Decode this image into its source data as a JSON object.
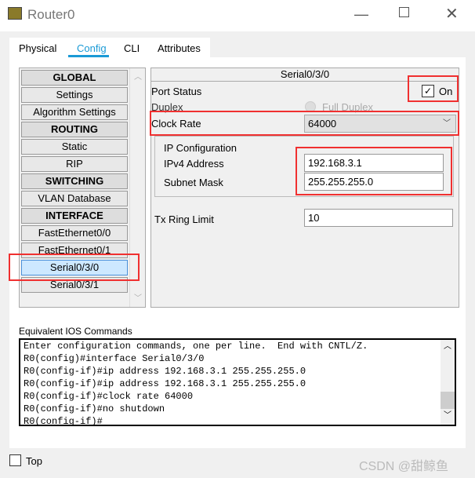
{
  "window": {
    "title": "Router0",
    "minimize_icon": "minimize-icon",
    "maximize_icon": "maximize-icon",
    "close_icon": "close-icon"
  },
  "tabs": [
    {
      "label": "Physical"
    },
    {
      "label": "Config",
      "active": true
    },
    {
      "label": "CLI"
    },
    {
      "label": "Attributes"
    }
  ],
  "accent": "#1a9ad6",
  "sidebar": {
    "items": [
      {
        "label": "GLOBAL",
        "header": true
      },
      {
        "label": "Settings"
      },
      {
        "label": "Algorithm Settings"
      },
      {
        "label": "ROUTING",
        "header": true
      },
      {
        "label": "Static"
      },
      {
        "label": "RIP"
      },
      {
        "label": "SWITCHING",
        "header": true
      },
      {
        "label": "VLAN Database"
      },
      {
        "label": "INTERFACE",
        "header": true
      },
      {
        "label": "FastEthernet0/0"
      },
      {
        "label": "FastEthernet0/1"
      },
      {
        "label": "Serial0/3/0",
        "selected": true
      },
      {
        "label": "Serial0/3/1"
      }
    ]
  },
  "interface": {
    "title": "Serial0/3/0",
    "port_status_label": "Port Status",
    "port_status_on": true,
    "on_label": "On",
    "duplex_label": "Duplex",
    "duplex_value": "Full Duplex",
    "clock_rate_label": "Clock Rate",
    "clock_rate_value": "64000",
    "ip_config_label": "IP Configuration",
    "ipv4_label": "IPv4 Address",
    "ipv4_value": "192.168.3.1",
    "mask_label": "Subnet Mask",
    "mask_value": "255.255.255.0",
    "tx_label": "Tx Ring Limit",
    "tx_value": "10"
  },
  "ios": {
    "label": "Equivalent IOS Commands",
    "lines": [
      "Enter configuration commands, one per line.  End with CNTL/Z.",
      "R0(config)#interface Serial0/3/0",
      "R0(config-if)#ip address 192.168.3.1 255.255.255.0",
      "R0(config-if)#ip address 192.168.3.1 255.255.255.0",
      "R0(config-if)#clock rate 64000",
      "R0(config-if)#no shutdown",
      "R0(config-if)#"
    ]
  },
  "footer": {
    "top_label": "Top",
    "top_checked": false,
    "watermark": "CSDN @甜鲸鱼"
  },
  "highlight_color": "#f03030"
}
